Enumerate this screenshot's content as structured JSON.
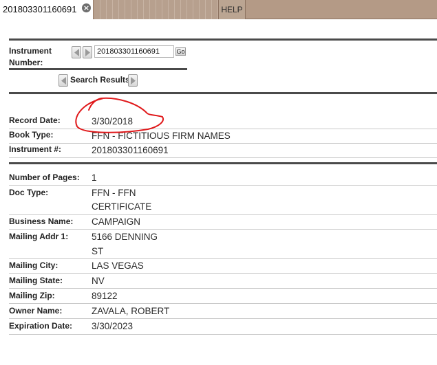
{
  "tabs": {
    "active_tab": "201803301160691",
    "help": "HELP"
  },
  "instrument_nav": {
    "label": "Instrument Number:",
    "value": "201803301160691",
    "go_label": "Go",
    "search_results_label": "Search Results"
  },
  "summary": [
    {
      "label": "Record Date:",
      "value": "3/30/2018"
    },
    {
      "label": "Book Type:",
      "value": "FFN - FICTITIOUS FIRM NAMES"
    },
    {
      "label": "Instrument #:",
      "value": "201803301160691"
    }
  ],
  "details": {
    "number_of_pages": {
      "label": "Number of Pages:",
      "value": "1"
    },
    "doc_type": {
      "label": "Doc Type:",
      "line1": "FFN - FFN",
      "line2": "CERTIFICATE"
    },
    "business_name": {
      "label": "Business Name:",
      "value": "CAMPAIGN"
    },
    "mailing_addr_1": {
      "label": "Mailing Addr 1:",
      "line1": "5166 DENNING",
      "line2": "ST"
    },
    "mailing_city": {
      "label": "Mailing City:",
      "value": "LAS VEGAS"
    },
    "mailing_state": {
      "label": "Mailing State:",
      "value": "NV"
    },
    "mailing_zip": {
      "label": "Mailing Zip:",
      "value": "89122"
    },
    "owner_name": {
      "label": "Owner Name:",
      "value": "ZAVALA, ROBERT"
    },
    "expiration_date": {
      "label": "Expiration Date:",
      "value": "3/30/2023"
    }
  },
  "colors": {
    "tab_bar": "#b49a86",
    "annotation_circle": "#e0191b",
    "rule": "#4a4a4a"
  }
}
